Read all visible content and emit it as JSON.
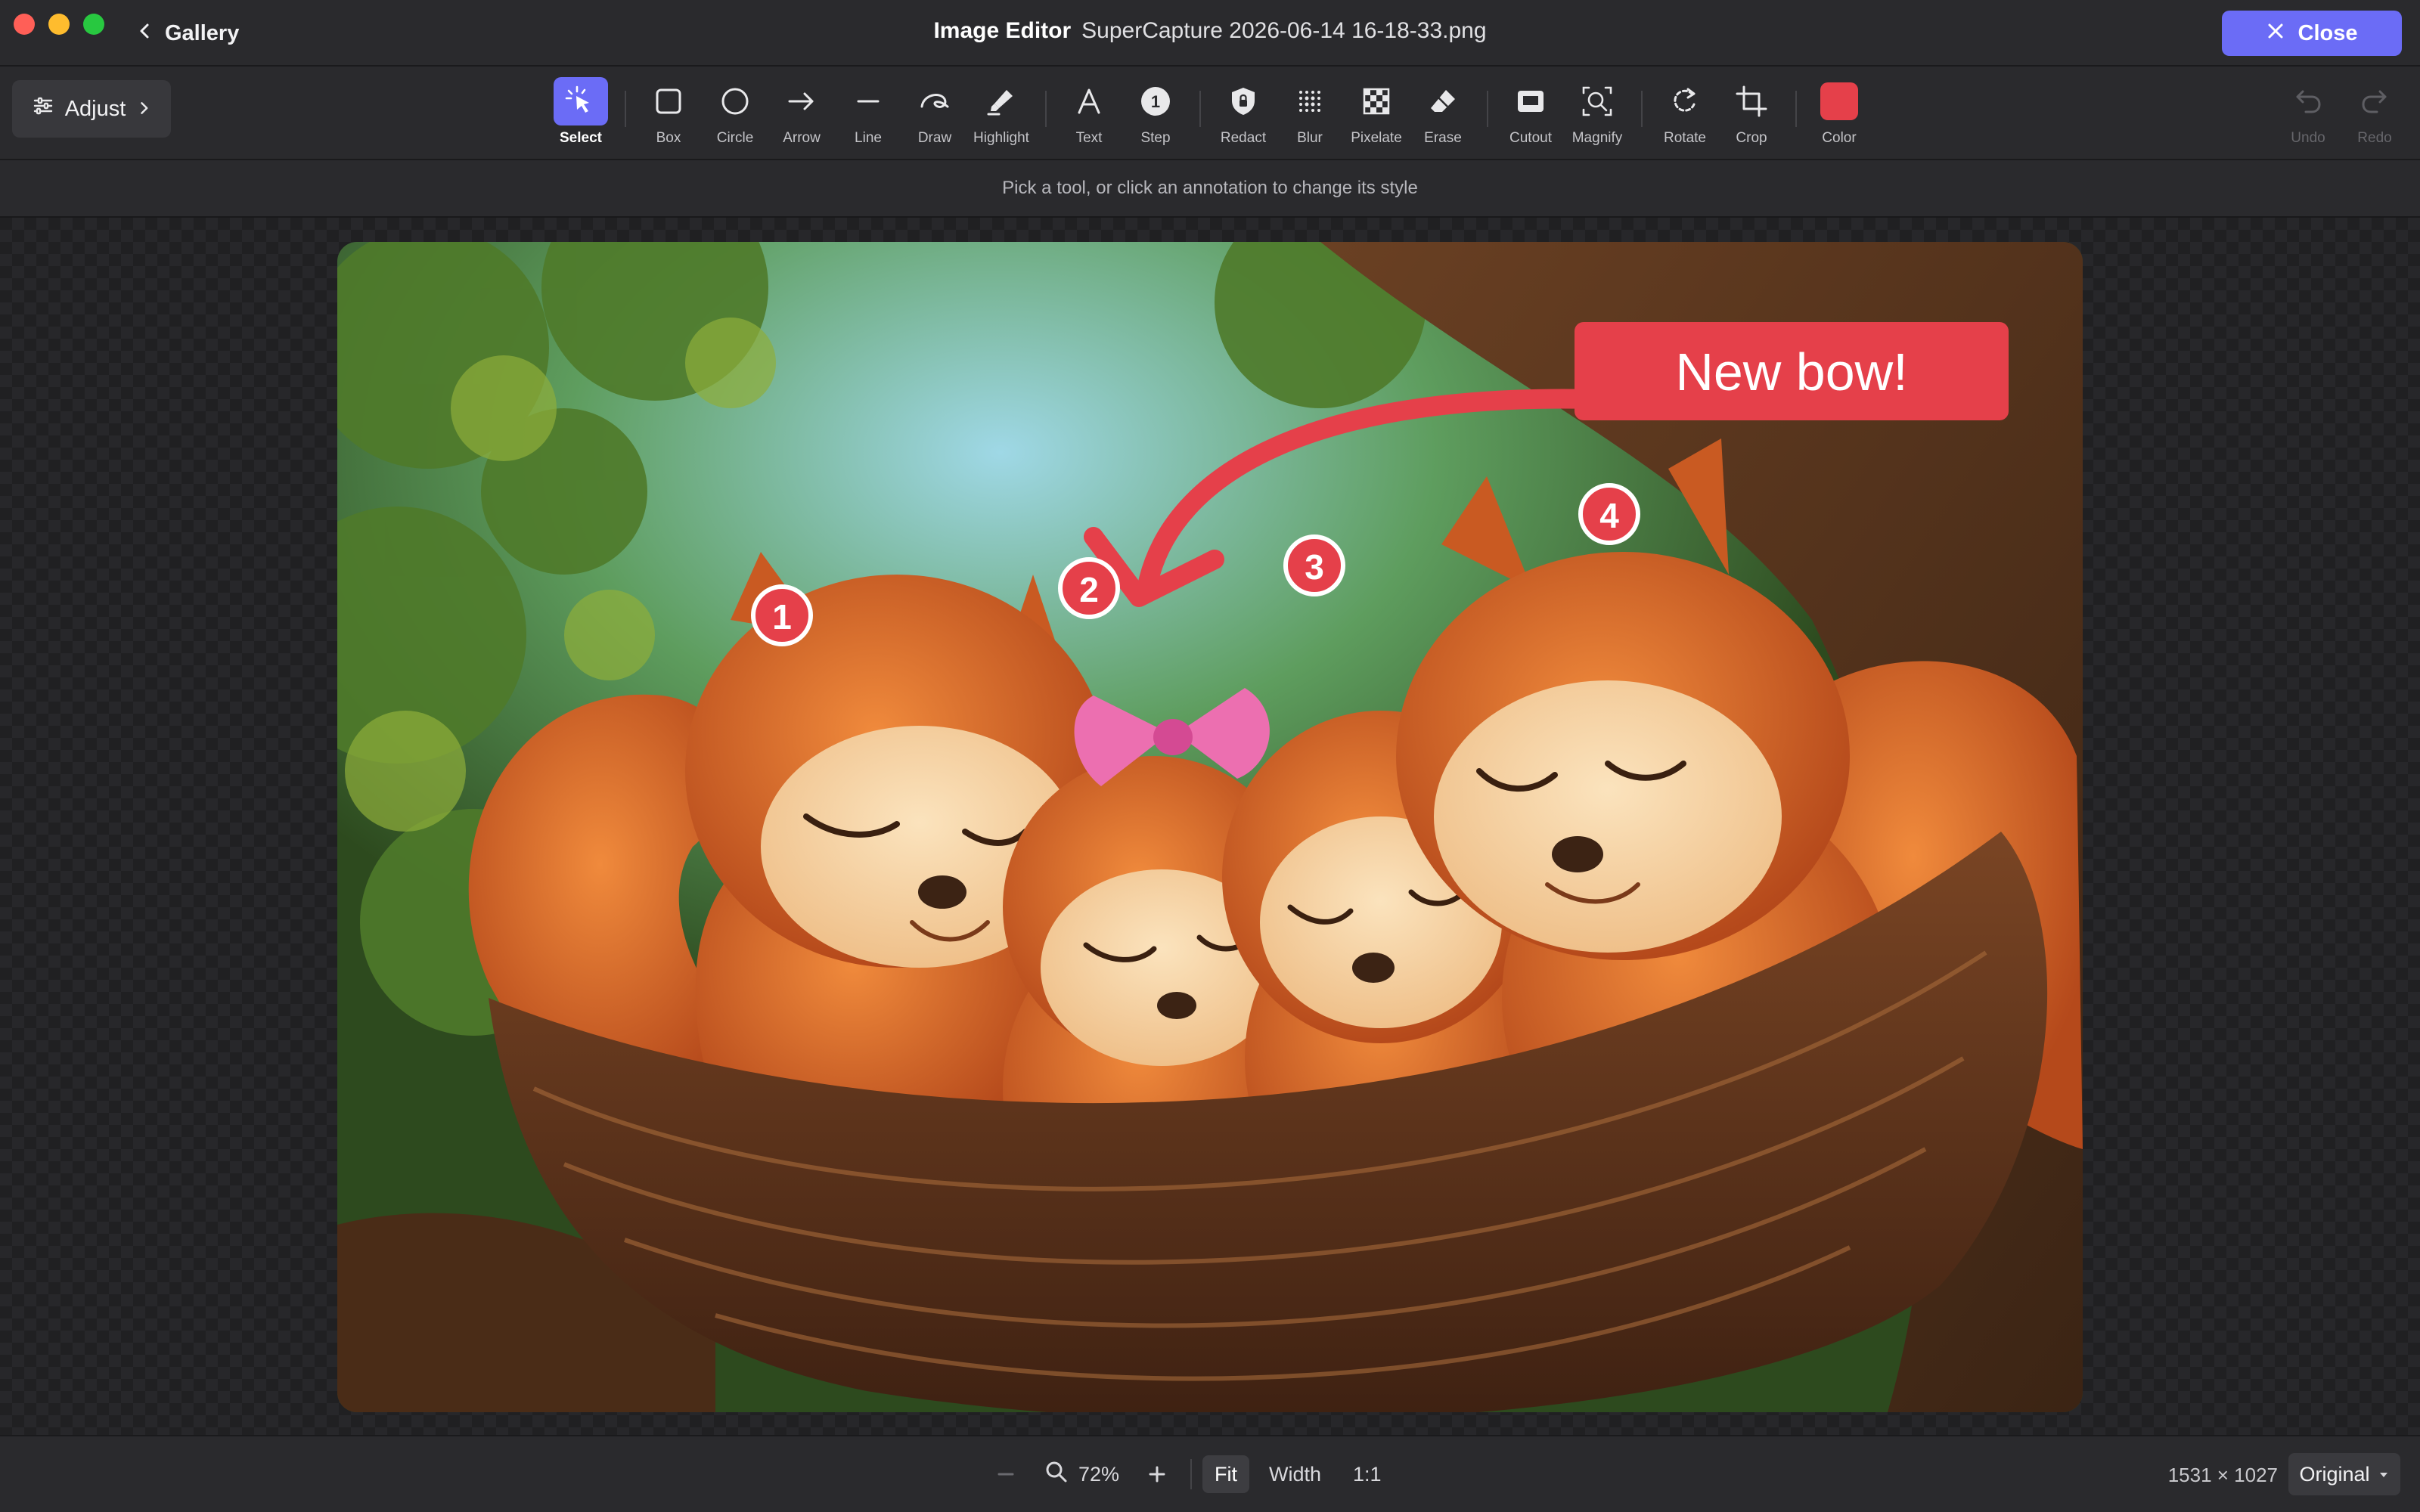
{
  "titlebar": {
    "back_label": "Gallery",
    "app_title": "Image Editor",
    "filename": "SuperCapture 2026-06-14 16-18-33.png",
    "close_label": "Close",
    "accent": "#6b6cf6"
  },
  "toolbar": {
    "adjust_label": "Adjust",
    "tools": {
      "select": "Select",
      "box": "Box",
      "circle": "Circle",
      "arrow": "Arrow",
      "line": "Line",
      "draw": "Draw",
      "highlight": "Highlight",
      "text": "Text",
      "step": "Step",
      "step_number": "1",
      "redact": "Redact",
      "blur": "Blur",
      "pixelate": "Pixelate",
      "erase": "Erase",
      "cutout": "Cutout",
      "magnify": "Magnify",
      "rotate": "Rotate",
      "crop": "Crop",
      "color": "Color",
      "undo": "Undo",
      "redo": "Redo"
    },
    "active_tool": "select",
    "current_color": "#e5404a"
  },
  "hint": "Pick a tool, or click an annotation to change its style",
  "annotations": {
    "callout_text": "New bow!",
    "annotation_color": "#e5404a",
    "steps": [
      "1",
      "2",
      "3",
      "4"
    ]
  },
  "status": {
    "zoom": "72%",
    "fit": "Fit",
    "width": "Width",
    "one_to_one": "1:1",
    "active_zoom_mode": "Fit",
    "dimensions": "1531 × 1027",
    "size_option": "Original"
  }
}
